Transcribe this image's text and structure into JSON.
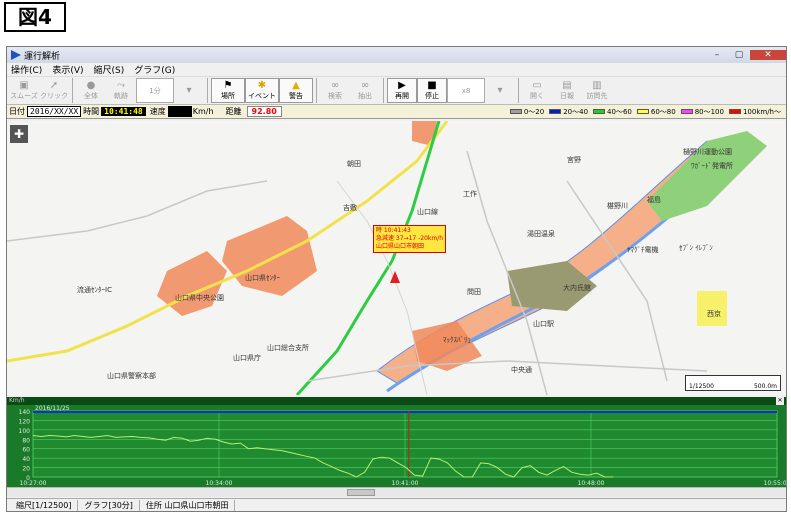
{
  "figure_label": "図4",
  "window": {
    "title": "運行解析",
    "controls": [
      "–",
      "▢",
      "✕"
    ]
  },
  "menu": [
    "操作(C)",
    "表示(V)",
    "縮尺(S)",
    "グラフ(G)"
  ],
  "toolbar": {
    "smooth": "スムーズ",
    "click": "クリック",
    "all": "全体",
    "trace": "軌跡",
    "interval": "1分",
    "location": "場所",
    "event": "イベント",
    "warning": "警告",
    "search": "検索",
    "extract": "抽出",
    "replay": "再開",
    "stop": "停止",
    "speed": "x8",
    "open": "開く",
    "report": "日報",
    "visit": "訪問先"
  },
  "infobar": {
    "date_label": "日付",
    "date": "2016/XX/XX",
    "time_label": "時間",
    "time": "10:41:48",
    "speed_label": "速度",
    "speed_unit": "Km/h",
    "distance_label": "距離",
    "distance": "92.80"
  },
  "speed_legend": [
    {
      "label": "0～20",
      "color": "#a0a0a0"
    },
    {
      "label": "20～40",
      "color": "#0020c0"
    },
    {
      "label": "40～60",
      "color": "#20d020"
    },
    {
      "label": "60～80",
      "color": "#ffff40"
    },
    {
      "label": "80～100",
      "color": "#ff40ff"
    },
    {
      "label": "100km/h～",
      "color": "#ff0000"
    }
  ],
  "map": {
    "labels": [
      "樋野川運動公園",
      "ﾜｶﾞｰﾄﾞ発電所",
      "流通ｾﾝﾀｰIC",
      "山口県中央公園",
      "山口県ｾﾝﾀｰ",
      "山口総合支所",
      "山口県警察本部",
      "山口県庁",
      "ﾏｯｸｽﾊﾞﾘｭ",
      "大内氏館",
      "山口駅",
      "朝田",
      "山口線",
      "工作",
      "椹野川",
      "湯田温泉",
      "ﾔﾏｸﾞﾁ電機",
      "ｾﾌﾞﾝ ｲﾚﾌﾞﾝ",
      "宮野",
      "福島",
      "西京",
      "吉敷",
      "問田",
      "中央通"
    ],
    "popup": [
      "時 10:41:43",
      "急減速 37→17 -20km/h",
      "山口県山口市朝田"
    ],
    "scale_left": "1/12500",
    "scale_right": "500.0m"
  },
  "graph": {
    "title": "Km/h",
    "close": "✕",
    "y_ticks": [
      "140",
      "120",
      "100",
      "80",
      "60",
      "40",
      "20",
      "0"
    ],
    "x_ticks": [
      "10:27:00",
      "10:34:00",
      "10:41:00",
      "10:48:00",
      "10:55:00"
    ],
    "date_label": "2016/11/25",
    "ymax": 140,
    "speed_series": [
      88,
      86,
      88,
      87,
      85,
      88,
      86,
      84,
      86,
      88,
      84,
      85,
      86,
      84,
      83,
      80,
      78,
      84,
      82,
      76,
      78,
      82,
      80,
      74,
      70,
      72,
      60,
      62,
      60,
      58,
      56,
      52,
      48,
      44,
      40,
      30,
      22,
      14,
      8,
      0,
      10,
      38,
      42,
      40,
      30,
      20,
      4,
      2,
      40,
      38,
      30,
      12,
      0,
      0,
      30,
      28,
      20,
      6,
      0,
      20,
      24,
      10,
      4,
      14,
      22,
      10,
      6,
      4,
      8,
      0,
      0
    ]
  },
  "statusbar": [
    "縮尺[1/12500]",
    "グラフ[30分]",
    "住所 山口県山口市朝田"
  ]
}
